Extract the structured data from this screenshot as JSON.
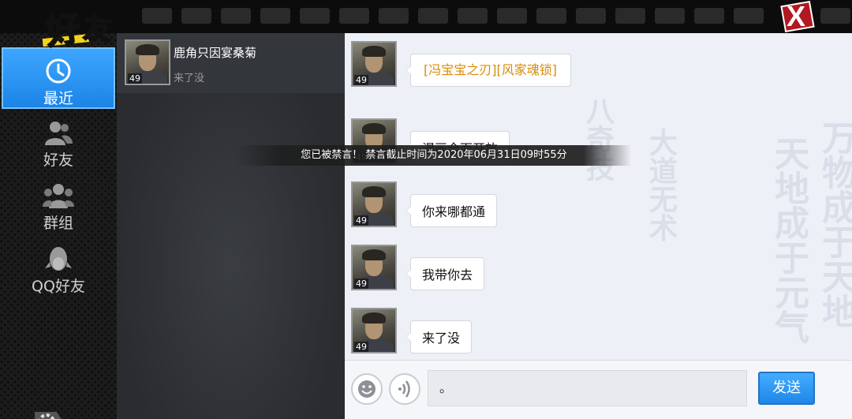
{
  "title": {
    "char1": "好",
    "char2": "友"
  },
  "close_label": "X",
  "nav": {
    "items": [
      {
        "label": "最近",
        "icon": "clock-icon",
        "active": true
      },
      {
        "label": "好友",
        "icon": "person-icon",
        "active": false
      },
      {
        "label": "群组",
        "icon": "group-icon",
        "active": false
      },
      {
        "label": "QQ好友",
        "icon": "qq-penguin-icon",
        "active": false
      }
    ],
    "settings_icon": "gear-icon"
  },
  "contacts": [
    {
      "name": "鹿角只因宴桑菊",
      "last_message": "来了没",
      "level": "49"
    }
  ],
  "messages": [
    {
      "text": "[冯宝宝之刃][风家魂锁]",
      "level": "49",
      "type": "item-link"
    },
    {
      "text": "漫画全面开放",
      "level": "49",
      "type": "text"
    },
    {
      "text": "你来哪都通",
      "level": "49",
      "type": "text"
    },
    {
      "text": "我带你去",
      "level": "49",
      "type": "text"
    },
    {
      "text": "来了没",
      "level": "49",
      "type": "text"
    }
  ],
  "mute_banner": "您已被禁言！ 禁言截止时间为2020年06月31日09时55分",
  "input": {
    "value": "。"
  },
  "send_label": "发送",
  "colors": {
    "active_tab": "#2b93f0",
    "item_link": "#d98c08",
    "title_yellow": "#f3d21c",
    "close_red": "#b01920"
  }
}
